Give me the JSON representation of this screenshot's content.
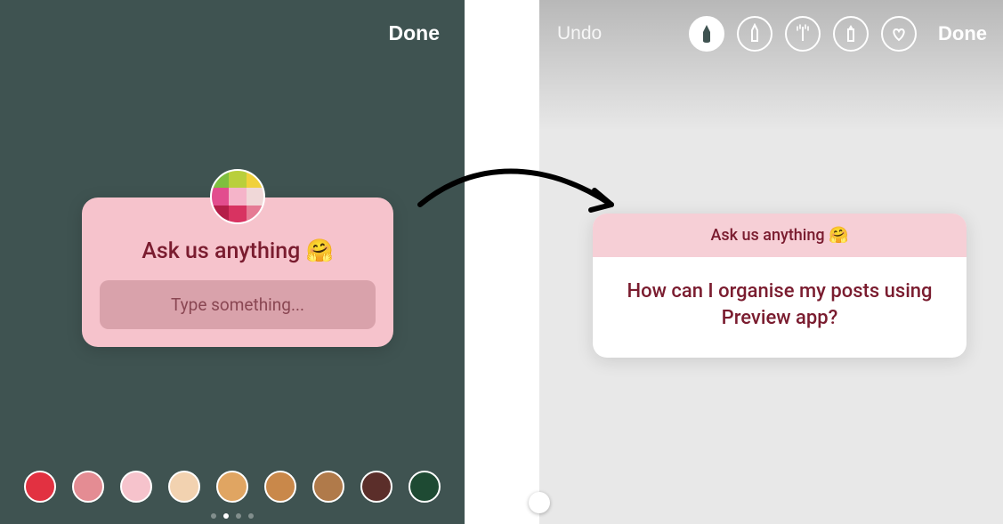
{
  "left": {
    "done_label": "Done",
    "card": {
      "title": "Ask us anything 🤗",
      "placeholder": "Type something..."
    },
    "swatches": [
      "#e23141",
      "#e48c93",
      "#f6c3cc",
      "#f2d2b0",
      "#e0a562",
      "#c9884a",
      "#b07a4a",
      "#5b2e2a",
      "#1e4a33"
    ],
    "pager_total": 4,
    "pager_active_index": 1
  },
  "right": {
    "undo_label": "Undo",
    "done_label": "Done",
    "tools": [
      {
        "name": "brush-pen-icon",
        "active": true
      },
      {
        "name": "marker-icon",
        "active": false
      },
      {
        "name": "neon-brush-icon",
        "active": false
      },
      {
        "name": "chisel-marker-icon",
        "active": false
      },
      {
        "name": "heart-stamp-icon",
        "active": false
      }
    ],
    "card": {
      "header": "Ask us anything 🤗",
      "body": "How can I organise my posts using Preview app?"
    }
  }
}
